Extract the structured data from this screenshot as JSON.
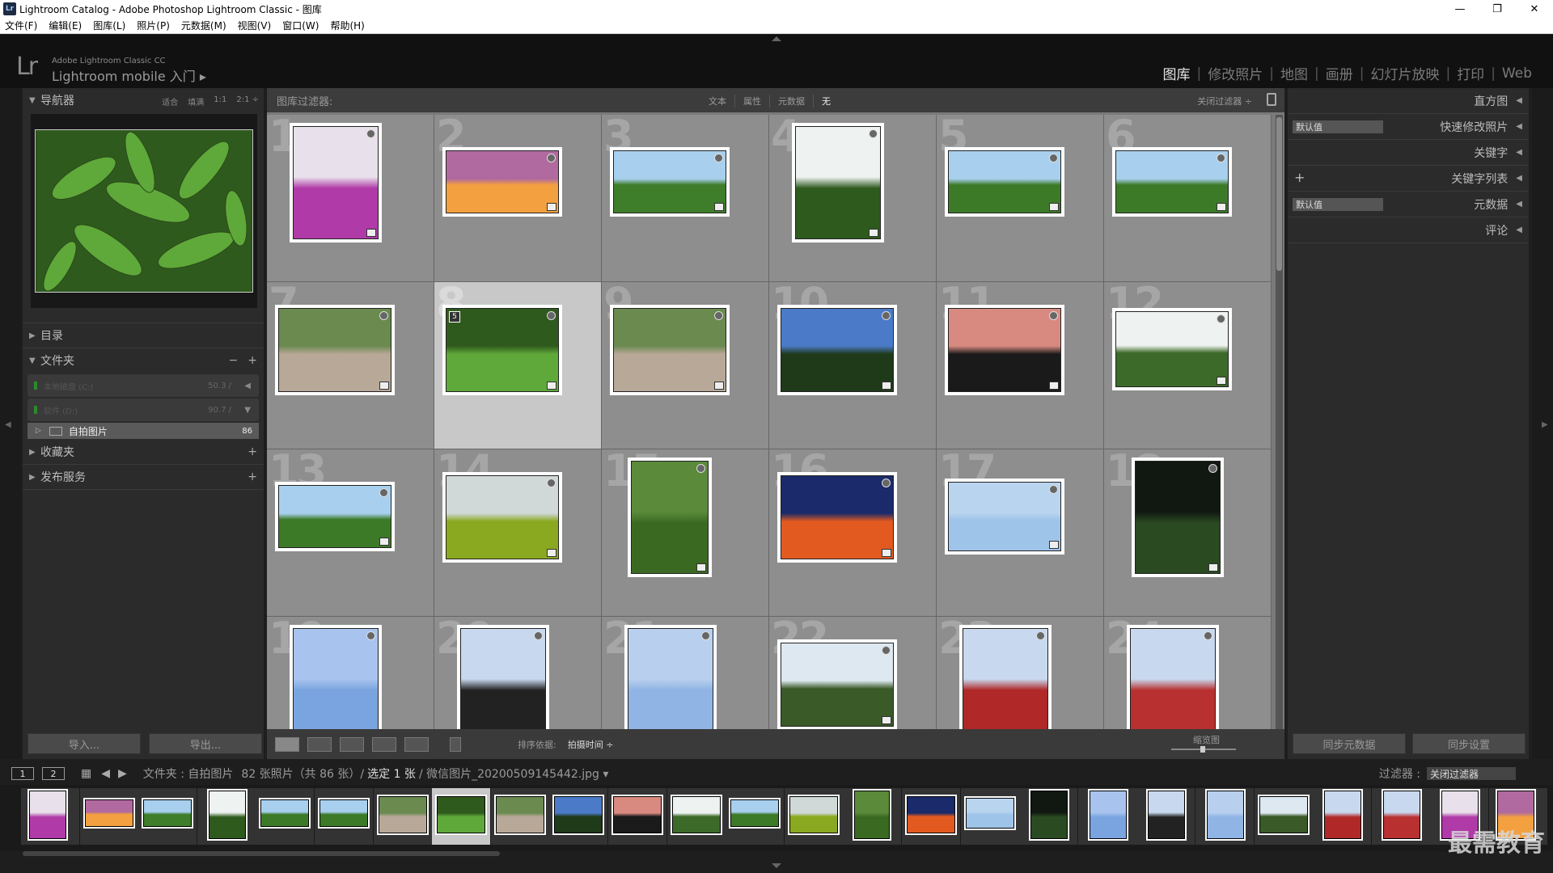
{
  "window": {
    "title": "Lightroom Catalog - Adobe Photoshop Lightroom Classic - 图库",
    "app_icon": "Lr",
    "buttons": [
      "—",
      "❐",
      "✕"
    ]
  },
  "menu": [
    "文件(F)",
    "编辑(E)",
    "图库(L)",
    "照片(P)",
    "元数据(M)",
    "视图(V)",
    "窗口(W)",
    "帮助(H)"
  ],
  "identity": {
    "logo": "Lr",
    "small": "Adobe Lightroom Classic CC",
    "big": "Lightroom mobile 入门 ▸"
  },
  "modules": [
    {
      "label": "图库",
      "active": true
    },
    {
      "label": "修改照片"
    },
    {
      "label": "地图"
    },
    {
      "label": "画册"
    },
    {
      "label": "幻灯片放映"
    },
    {
      "label": "打印"
    },
    {
      "label": "Web"
    }
  ],
  "left": {
    "navigator": {
      "title": "导航器",
      "options": [
        "适合",
        "填满",
        "1:1",
        "2:1 ÷"
      ]
    },
    "catalog": "目录",
    "folders": {
      "title": "文件夹",
      "volumes": [
        {
          "name": "本地磁盘 (C:)",
          "size": "50.3 /"
        },
        {
          "name": "软件 (D:)",
          "size": "90.7 /"
        }
      ],
      "folder": {
        "name": "自拍图片",
        "count": "86"
      }
    },
    "collections": "收藏夹",
    "publish": "发布服务",
    "import_btn": "导入...",
    "export_btn": "导出..."
  },
  "filter": {
    "label": "图库过滤器:",
    "tabs": [
      "文本",
      "属性",
      "元数据",
      "无"
    ],
    "active": "无",
    "close": "关闭过滤器 ÷"
  },
  "grid": {
    "cells": [
      "1",
      "2",
      "3",
      "4",
      "5",
      "6",
      "7",
      "8",
      "9",
      "10",
      "11",
      "12",
      "13",
      "14",
      "15",
      "16",
      "17",
      "18",
      "19",
      "20",
      "21",
      "22",
      "23",
      "24"
    ],
    "selected_index": "8",
    "stack_count": "5"
  },
  "toolbar": {
    "sort_label": "排序依据:",
    "sort_value": "拍摄时间 ÷",
    "thumb_label": "缩览图"
  },
  "right": {
    "rows": [
      {
        "label": "直方图"
      },
      {
        "label": "快速修改照片",
        "select": "默认值"
      },
      {
        "label": "关键字"
      },
      {
        "label": "关键字列表",
        "plus": "+"
      },
      {
        "label": "元数据",
        "select": "默认值"
      },
      {
        "label": "评论"
      }
    ],
    "sync_meta": "同步元数据",
    "sync_settings": "同步设置"
  },
  "filmbar": {
    "pages": [
      "1",
      "2"
    ],
    "path_prefix": "文件夹 : 自拍图片",
    "path_count": "82 张照片（共 86 张）/",
    "path_sel": "选定 1 张",
    "path_file": "/ 微信图片_20200509145442.jpg ▾",
    "filter_label": "过滤器 :",
    "filter_value": "关闭过滤器"
  },
  "watermark": "最需教育",
  "colors": {
    "accent": "#e6e6e6",
    "panel": "#2b2b2b",
    "grid_bg": "#8e8e8e"
  }
}
